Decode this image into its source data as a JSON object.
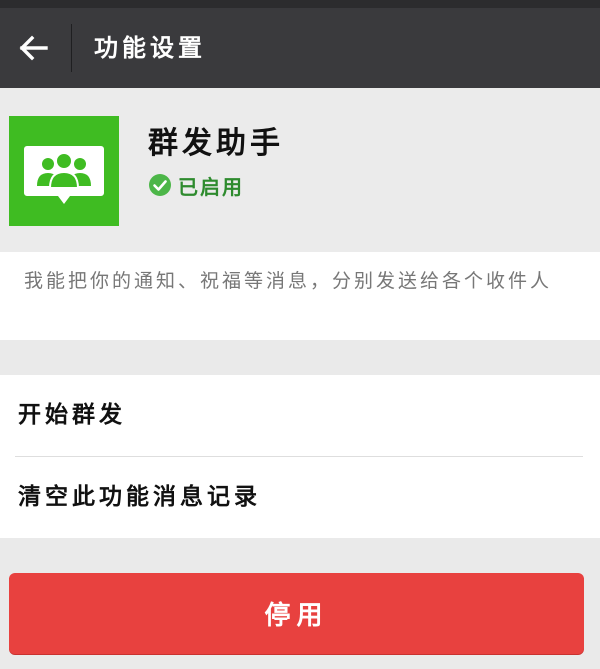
{
  "navbar": {
    "back_icon": "arrow-left-icon",
    "title": "功能设置"
  },
  "app": {
    "icon": "group-chat-icon",
    "icon_color": "#3fbc22",
    "name": "群发助手",
    "status_icon": "check-circle-icon",
    "status_color": "#2e8b2e",
    "status": "已启用"
  },
  "description": "我能把你的通知、祝福等消息，分别发送给各个收件人",
  "menu": {
    "items": [
      {
        "label": "开始群发"
      },
      {
        "label": "清空此功能消息记录"
      }
    ]
  },
  "actions": {
    "disable_label": "停用",
    "disable_color": "#e8413f"
  }
}
